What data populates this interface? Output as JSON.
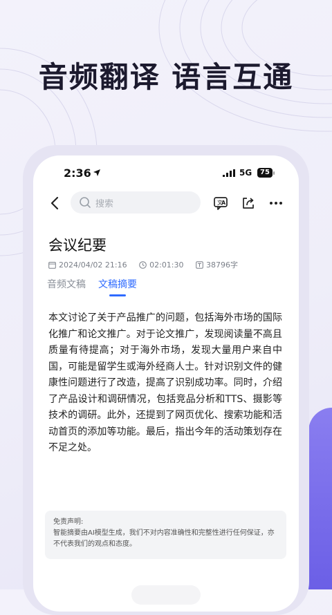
{
  "headline": "音频翻译 语言互通",
  "status_bar": {
    "time": "2:36",
    "network": "5G",
    "battery": "75"
  },
  "toolbar": {
    "search_placeholder": "搜索"
  },
  "document": {
    "title": "会议纪要",
    "date": "2024/04/02 21:16",
    "duration": "02:01:30",
    "word_count": "38796字"
  },
  "tabs": [
    {
      "label": "音频文稿",
      "active": false
    },
    {
      "label": "文稿摘要",
      "active": true
    }
  ],
  "summary_text": "本文讨论了关于产品推广的问题，包括海外市场的国际化推广和论文推广。对于论文推广，发现阅读量不高且质量有待提高；对于海外市场，发现大量用户来自中国，可能是留学生或海外经商人士。针对识别文件的健康性问题进行了改造，提高了识别成功率。同时，介绍了产品设计和调研情况，包括竞品分析和TTS、摄影等技术的调研。此外，还提到了网页优化、搜索功能和活动首页的添加等功能。最后，指出今年的活动策划存在不足之处。",
  "disclaimer": {
    "title": "免责声明:",
    "text": "智能摘要由AI模型生成，我们不对内容准确性和完整性进行任何保证，亦不代表我们的观点和态度。"
  },
  "colors": {
    "accent": "#2f6bff",
    "side_accent": "#7a6eec"
  },
  "icons": [
    "location-arrow-icon",
    "signal-icon",
    "back-arrow-icon",
    "search-icon",
    "translate-icon",
    "share-icon",
    "more-icon",
    "calendar-icon",
    "clock-icon",
    "text-count-icon"
  ]
}
